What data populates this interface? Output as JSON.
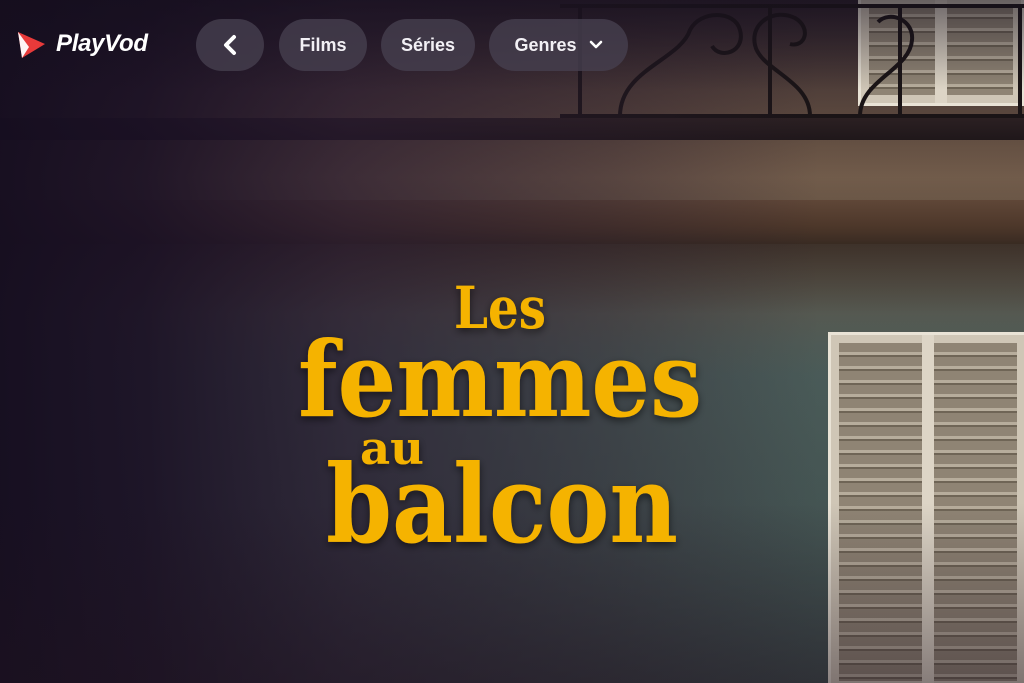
{
  "brand": {
    "name": "PlayVod",
    "logo_icon": "play-triangle-icon",
    "accent_color": "#e83a3a"
  },
  "nav": {
    "back_icon": "chevron-left-icon",
    "items": [
      {
        "label": "Films"
      },
      {
        "label": "Séries"
      },
      {
        "label": "Genres",
        "icon": "chevron-down-icon"
      }
    ]
  },
  "hero": {
    "title_lines": [
      "Les",
      "femmes",
      "au",
      "balcon"
    ],
    "title_color": "#f5b300"
  }
}
